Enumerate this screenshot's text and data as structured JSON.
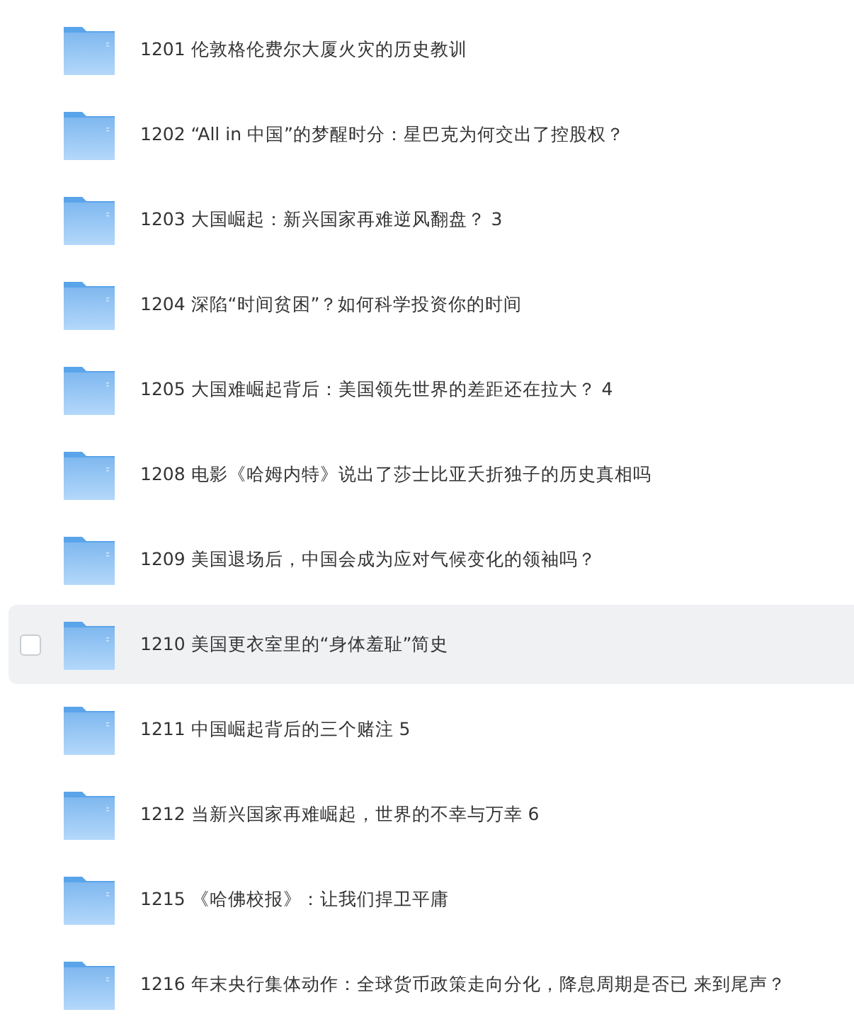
{
  "folders": [
    {
      "name": "1201 伦敦格伦费尔大厦火灾的历史教训",
      "hovered": false
    },
    {
      "name": "1202 “All in 中国”的梦醒时分：星巴克为何交出了控股权？",
      "hovered": false
    },
    {
      "name": "1203 大国崛起：新兴国家再难逆风翻盘？ 3",
      "hovered": false
    },
    {
      "name": "1204 深陷“时间贫困”？如何科学投资你的时间",
      "hovered": false
    },
    {
      "name": "1205 大国难崛起背后：美国领先世界的差距还在拉大？ 4",
      "hovered": false
    },
    {
      "name": "1208 电影《哈姆内特》说出了莎士比亚夭折独子的历史真相吗",
      "hovered": false
    },
    {
      "name": "1209 美国退场后，中国会成为应对气候变化的领袖吗？",
      "hovered": false
    },
    {
      "name": "1210 美国更衣室里的“身体羞耻”简史",
      "hovered": true
    },
    {
      "name": "1211 中国崛起背后的三个赌注 5",
      "hovered": false
    },
    {
      "name": "1212 当新兴国家再难崛起，世界的不幸与万幸 6",
      "hovered": false
    },
    {
      "name": "1215 《哈佛校报》：让我们捍卫平庸",
      "hovered": false
    },
    {
      "name": "1216 年末央行集体动作：全球货币政策走向分化，降息周期是否已 来到尾声？",
      "hovered": false
    }
  ]
}
